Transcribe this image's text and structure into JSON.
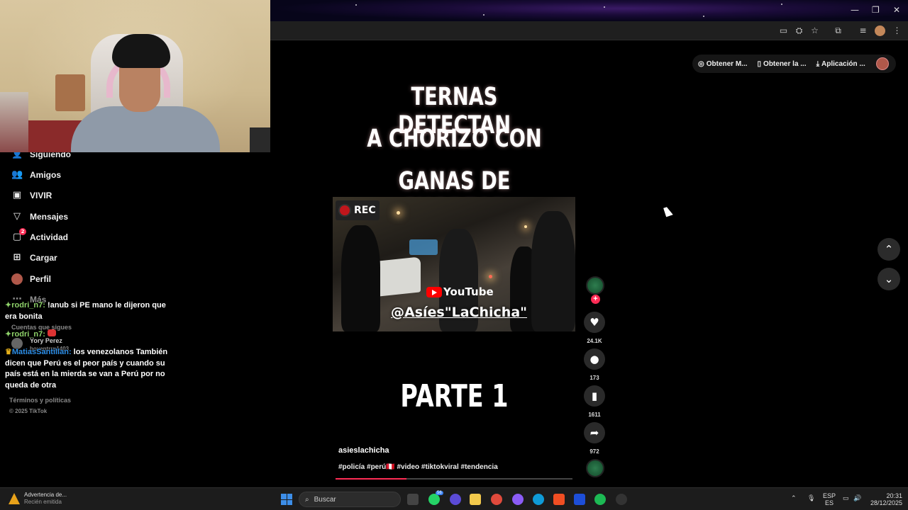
{
  "browser": {
    "window_controls": {
      "minimize": "—",
      "restore": "❐",
      "close": "✕"
    },
    "toolbar_icons": [
      "cast-icon",
      "translate-icon",
      "star-icon",
      "extensions-icon",
      "media-icon",
      "profile-icon",
      "menu-icon"
    ]
  },
  "header": {
    "get_m_label": "Obtener M...",
    "get_la_label": "Obtener la ...",
    "app_label": "Aplicación ..."
  },
  "sidebar": {
    "items": [
      {
        "label": "Siguiendo",
        "icon": "following-icon"
      },
      {
        "label": "Amigos",
        "icon": "friends-icon"
      },
      {
        "label": "VIVIR",
        "icon": "live-icon"
      },
      {
        "label": "Mensajes",
        "icon": "messages-icon"
      },
      {
        "label": "Actividad",
        "icon": "activity-icon",
        "badge": "2"
      },
      {
        "label": "Cargar",
        "icon": "upload-icon"
      },
      {
        "label": "Perfil",
        "icon": "profile-avatar"
      },
      {
        "label": "Más",
        "icon": "more-icon"
      }
    ],
    "following_heading": "Cuentas que sigues",
    "following_name": "Yory Perez",
    "following_handle": "boyentrrp1403",
    "terms": "Términos y políticas",
    "copyright": "© 2025 TikTok"
  },
  "chat": [
    {
      "user": "rodri_n7:",
      "text": " !anub si PE mano le dijeron que era bonita"
    },
    {
      "user": "rodri_n7:",
      "text": ""
    },
    {
      "user": "MatiasSantillan:",
      "text": " los venezolanos También dicen que Perú es el peor país y cuando su país está en la mierda se van a Perú por no queda de otra"
    }
  ],
  "video": {
    "title_lines": [
      "TERNAS DETECTAN",
      "A CHORIZO CON",
      "GANAS DE CHOREAR"
    ],
    "rec_label": "REC",
    "youtube_label": "YouTube",
    "handle": "@Asíes\"LaChicha\"",
    "part_label": "PARTE 1",
    "author": "asieslachicha",
    "tags": "#policía #perú🇵🇪 #video #tiktokviral #tendencia",
    "progress": 0.3
  },
  "actions": {
    "likes": "24.1K",
    "comments": "173",
    "saves": "1611",
    "shares": "972"
  },
  "taskbar": {
    "notif_title": "Advertencia de...",
    "notif_sub": "Recién emitida",
    "search_placeholder": "Buscar",
    "whatsapp_badge": "56",
    "lang_top": "ESP",
    "lang_bottom": "ES",
    "time": "20:31",
    "date": "28/12/2025"
  },
  "colors": {
    "accent": "#fe2c55",
    "chat_user_green": "#8fd36a",
    "chat_user_blue": "#2d8fe8"
  }
}
